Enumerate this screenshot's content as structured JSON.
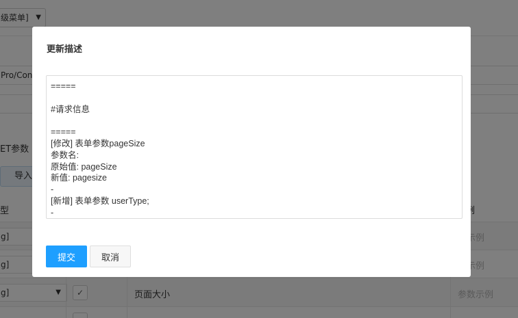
{
  "background": {
    "menu_select": {
      "value": "级菜单]",
      "arrow": "▼"
    },
    "url_value": "Pro/Con",
    "get_params_label": "ET参数",
    "import_button": "导入",
    "table": {
      "header_left": "型",
      "header_right": "例",
      "rows": [
        {
          "type": "g]",
          "example": "数示例"
        },
        {
          "type": "g]",
          "example": "数示例"
        },
        {
          "type": "g]",
          "arrow": "▼",
          "checked": "✓",
          "description": "页面大小",
          "example": "参数示例"
        }
      ]
    }
  },
  "modal": {
    "title": "更新描述",
    "textarea": {
      "lines": [
        "=====",
        "",
        "#请求信息",
        "",
        "=====",
        "[修改] 表单参数pageSize",
        "参数名:",
        "原始值: pageSize",
        "新值: pagesize",
        "-",
        "[新增] 表单参数 userType;",
        "-"
      ]
    },
    "submit_label": "提交",
    "cancel_label": "取消"
  },
  "colors": {
    "primary": "#1e9fff",
    "overlay": "rgba(0,0,0,0.5)",
    "border": "#dcdcdc"
  }
}
